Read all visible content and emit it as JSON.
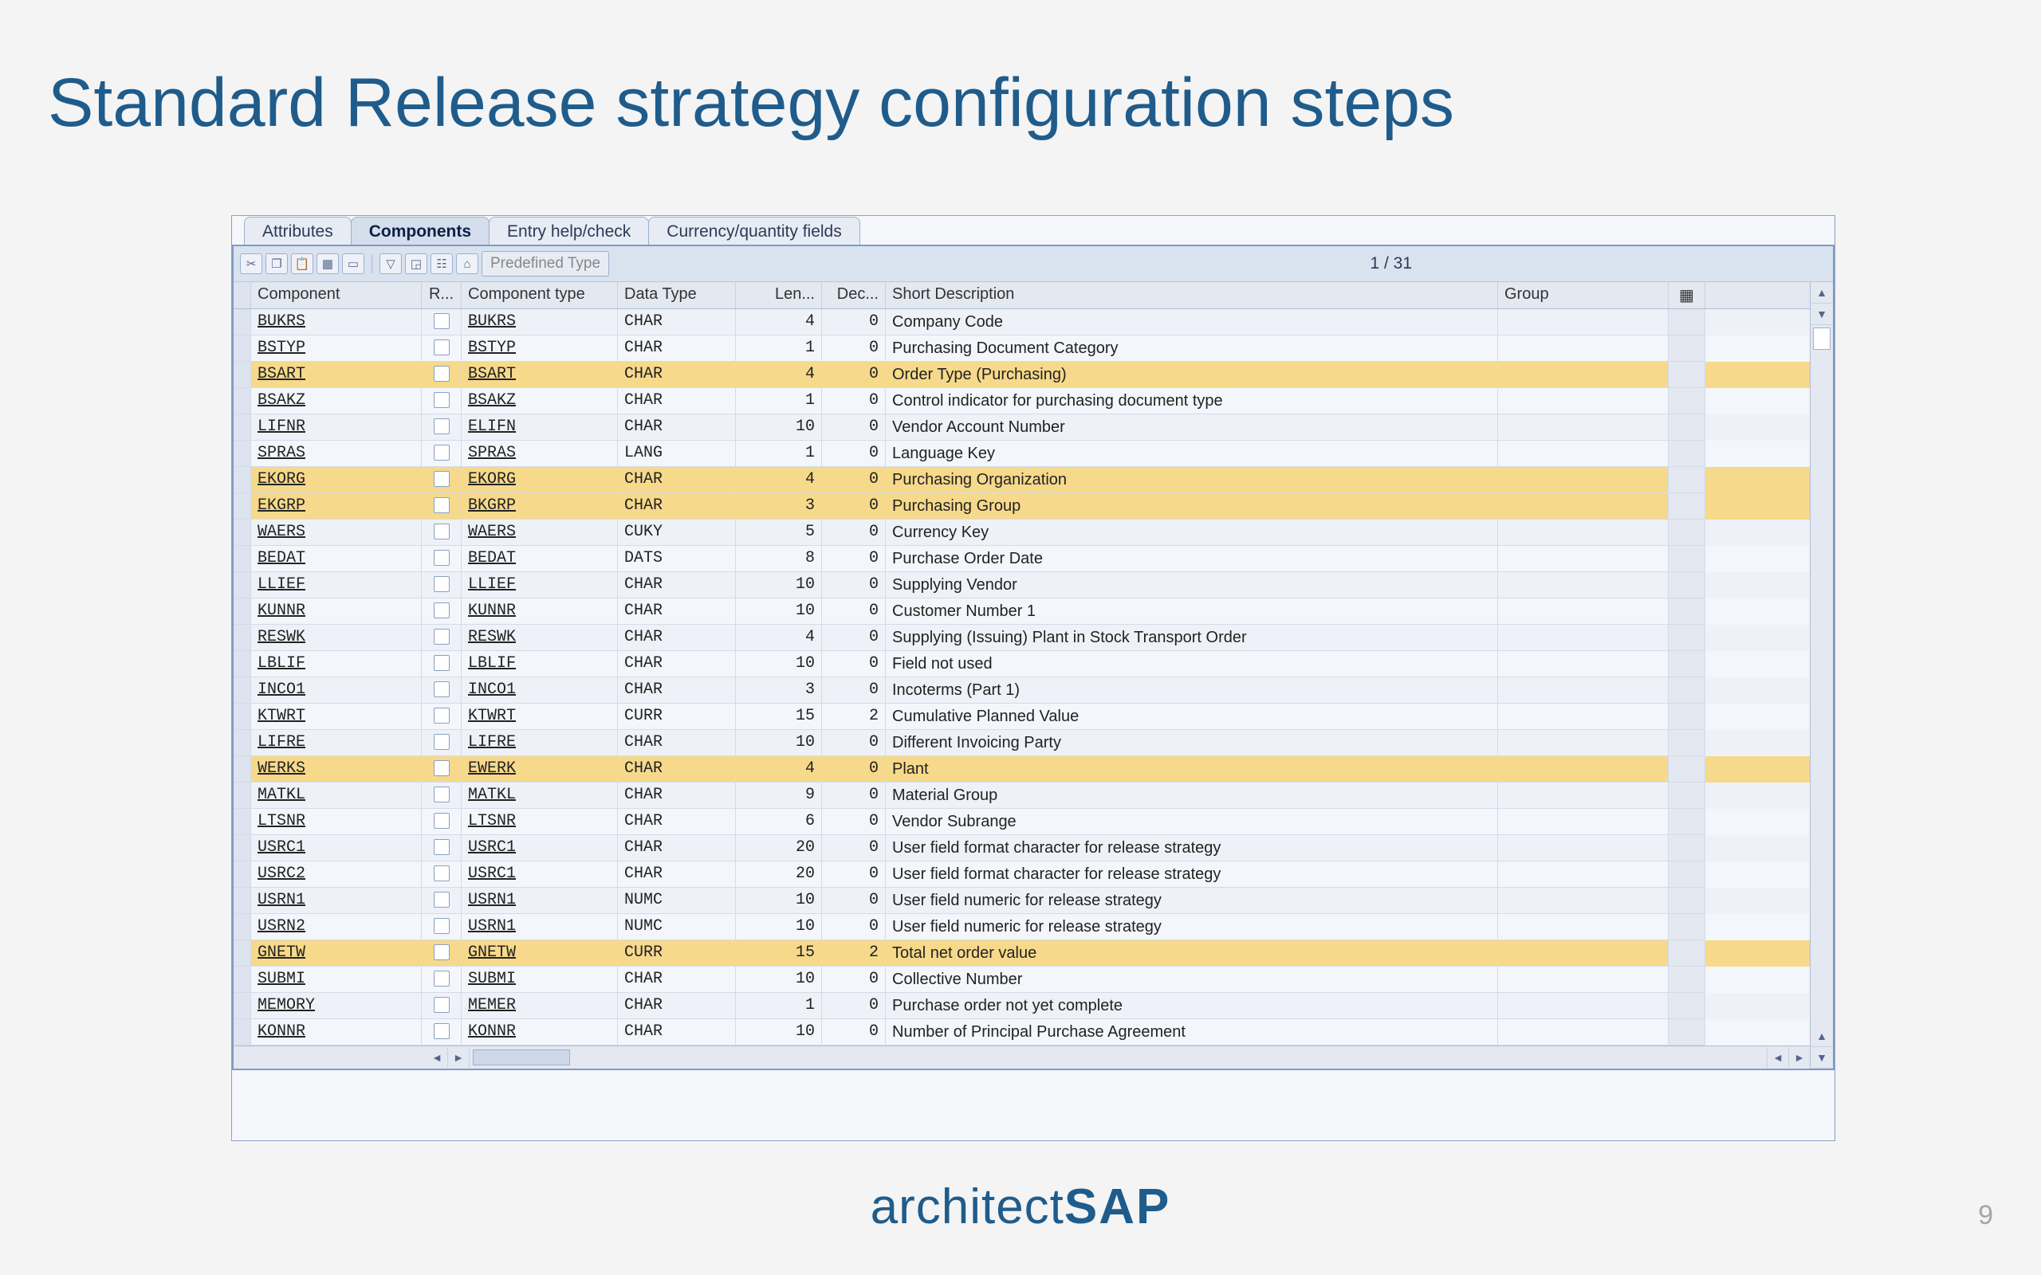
{
  "title": "Standard Release strategy configuration steps",
  "tabs": {
    "t0": "Attributes",
    "t1": "Components",
    "t2": "Entry help/check",
    "t3": "Currency/quantity fields",
    "activeIndex": 1
  },
  "toolbar": {
    "predefined": "Predefined Type",
    "pager": "1 / 31"
  },
  "columns": {
    "c1": "Component",
    "c2": "R...",
    "c3": "Component type",
    "c4": "Data Type",
    "c5": "Len...",
    "c6": "Dec...",
    "c7": "Short Description",
    "c8": "Group"
  },
  "rows": [
    {
      "hl": false,
      "component": "BUKRS",
      "ctype": "BUKRS",
      "dtype": "CHAR",
      "len": "4",
      "dec": "0",
      "desc": "Company Code"
    },
    {
      "hl": false,
      "component": "BSTYP",
      "ctype": "BSTYP",
      "dtype": "CHAR",
      "len": "1",
      "dec": "0",
      "desc": "Purchasing Document Category"
    },
    {
      "hl": true,
      "component": "BSART",
      "ctype": "BSART",
      "dtype": "CHAR",
      "len": "4",
      "dec": "0",
      "desc": "Order Type (Purchasing)"
    },
    {
      "hl": false,
      "component": "BSAKZ",
      "ctype": "BSAKZ",
      "dtype": "CHAR",
      "len": "1",
      "dec": "0",
      "desc": "Control indicator for purchasing document type"
    },
    {
      "hl": false,
      "component": "LIFNR",
      "ctype": "ELIFN",
      "dtype": "CHAR",
      "len": "10",
      "dec": "0",
      "desc": "Vendor Account Number"
    },
    {
      "hl": false,
      "component": "SPRAS",
      "ctype": "SPRAS",
      "dtype": "LANG",
      "len": "1",
      "dec": "0",
      "desc": "Language Key"
    },
    {
      "hl": true,
      "component": "EKORG",
      "ctype": "EKORG",
      "dtype": "CHAR",
      "len": "4",
      "dec": "0",
      "desc": "Purchasing Organization"
    },
    {
      "hl": true,
      "component": "EKGRP",
      "ctype": "BKGRP",
      "dtype": "CHAR",
      "len": "3",
      "dec": "0",
      "desc": "Purchasing Group"
    },
    {
      "hl": false,
      "component": "WAERS",
      "ctype": "WAERS",
      "dtype": "CUKY",
      "len": "5",
      "dec": "0",
      "desc": "Currency Key"
    },
    {
      "hl": false,
      "component": "BEDAT",
      "ctype": "BEDAT",
      "dtype": "DATS",
      "len": "8",
      "dec": "0",
      "desc": "Purchase Order Date"
    },
    {
      "hl": false,
      "component": "LLIEF",
      "ctype": "LLIEF",
      "dtype": "CHAR",
      "len": "10",
      "dec": "0",
      "desc": "Supplying Vendor"
    },
    {
      "hl": false,
      "component": "KUNNR",
      "ctype": "KUNNR",
      "dtype": "CHAR",
      "len": "10",
      "dec": "0",
      "desc": "Customer Number 1"
    },
    {
      "hl": false,
      "component": "RESWK",
      "ctype": "RESWK",
      "dtype": "CHAR",
      "len": "4",
      "dec": "0",
      "desc": "Supplying (Issuing) Plant in Stock Transport Order"
    },
    {
      "hl": false,
      "component": "LBLIF",
      "ctype": "LBLIF",
      "dtype": "CHAR",
      "len": "10",
      "dec": "0",
      "desc": "Field not used"
    },
    {
      "hl": false,
      "component": "INCO1",
      "ctype": "INCO1",
      "dtype": "CHAR",
      "len": "3",
      "dec": "0",
      "desc": "Incoterms (Part 1)"
    },
    {
      "hl": false,
      "component": "KTWRT",
      "ctype": "KTWRT",
      "dtype": "CURR",
      "len": "15",
      "dec": "2",
      "desc": "Cumulative Planned Value"
    },
    {
      "hl": false,
      "component": "LIFRE",
      "ctype": "LIFRE",
      "dtype": "CHAR",
      "len": "10",
      "dec": "0",
      "desc": "Different Invoicing Party"
    },
    {
      "hl": true,
      "component": "WERKS",
      "ctype": "EWERK",
      "dtype": "CHAR",
      "len": "4",
      "dec": "0",
      "desc": "Plant"
    },
    {
      "hl": false,
      "component": "MATKL",
      "ctype": "MATKL",
      "dtype": "CHAR",
      "len": "9",
      "dec": "0",
      "desc": "Material Group"
    },
    {
      "hl": false,
      "component": "LTSNR",
      "ctype": "LTSNR",
      "dtype": "CHAR",
      "len": "6",
      "dec": "0",
      "desc": "Vendor Subrange"
    },
    {
      "hl": false,
      "component": "USRC1",
      "ctype": "USRC1",
      "dtype": "CHAR",
      "len": "20",
      "dec": "0",
      "desc": "User field format character for release strategy"
    },
    {
      "hl": false,
      "component": "USRC2",
      "ctype": "USRC1",
      "dtype": "CHAR",
      "len": "20",
      "dec": "0",
      "desc": "User field format character for release strategy"
    },
    {
      "hl": false,
      "component": "USRN1",
      "ctype": "USRN1",
      "dtype": "NUMC",
      "len": "10",
      "dec": "0",
      "desc": "User field numeric for release strategy"
    },
    {
      "hl": false,
      "component": "USRN2",
      "ctype": "USRN1",
      "dtype": "NUMC",
      "len": "10",
      "dec": "0",
      "desc": "User field numeric for release strategy"
    },
    {
      "hl": true,
      "component": "GNETW",
      "ctype": "GNETW",
      "dtype": "CURR",
      "len": "15",
      "dec": "2",
      "desc": "Total net order value"
    },
    {
      "hl": false,
      "component": "SUBMI",
      "ctype": "SUBMI",
      "dtype": "CHAR",
      "len": "10",
      "dec": "0",
      "desc": "Collective Number"
    },
    {
      "hl": false,
      "component": "MEMORY",
      "ctype": "MEMER",
      "dtype": "CHAR",
      "len": "1",
      "dec": "0",
      "desc": "Purchase order not yet complete"
    },
    {
      "hl": false,
      "component": "KONNR",
      "ctype": "KONNR",
      "dtype": "CHAR",
      "len": "10",
      "dec": "0",
      "desc": "Number of Principal Purchase Agreement"
    }
  ],
  "brand": {
    "a": "architect",
    "b": "SAP"
  },
  "pageNumber": "9"
}
